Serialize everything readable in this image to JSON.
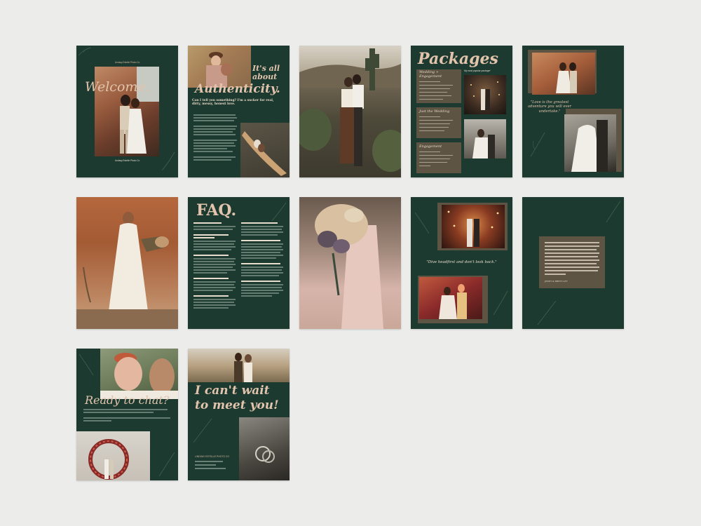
{
  "colors": {
    "green": "#1c3a30",
    "tan": "#5d5443",
    "blush": "#d8b9a0",
    "bg": "#ececeb"
  },
  "pages": {
    "p1": {
      "brand": "Lindsay Estelle Photo Co",
      "title": "Welcome.",
      "footer": "Lindsay Estelle Photo Co"
    },
    "p2": {
      "heading1": "It's all",
      "heading2": "about",
      "heading3": "Authenticity.",
      "subheading": "Can I tell you something? I'm a sucker for real, dirty, messy, honest love."
    },
    "p4": {
      "title": "Packages",
      "popular": "My most popular package!",
      "pkg1_title": "Wedding + Engagement",
      "pkg2_title": "Just the Wedding",
      "pkg3_title": "Engagement"
    },
    "p5": {
      "quote": "\"Love is the greatest adventure you will ever undertake.\""
    },
    "p7": {
      "title": "FAQ."
    },
    "p9": {
      "quote": "\"Dive headfirst and don't look back.\""
    },
    "p10": {
      "signature": "JENEY & BRETT LEY"
    },
    "p11": {
      "title": "Ready to chat?"
    },
    "p12": {
      "title1": "I can't wait",
      "title2": "to meet you!",
      "brand": "LINDSAY ESTELLE PHOTO CO"
    }
  }
}
